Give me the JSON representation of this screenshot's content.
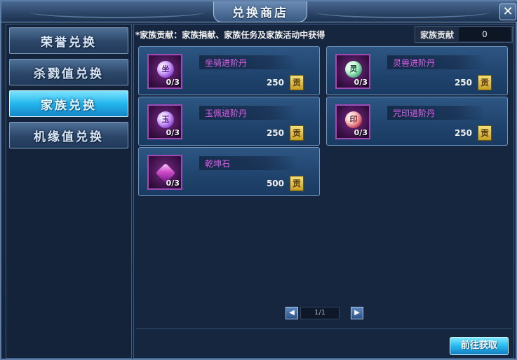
{
  "window": {
    "title": "兑换商店",
    "close_glyph": "✕"
  },
  "sidebar": {
    "tabs": [
      {
        "label": "荣誉兑换",
        "active": false
      },
      {
        "label": "杀戮值兑换",
        "active": false
      },
      {
        "label": "家族兑换",
        "active": true
      },
      {
        "label": "机缘值兑换",
        "active": false
      }
    ]
  },
  "main": {
    "notice": "*家族贡献：家族捐献、家族任务及家族活动中获得",
    "contribution": {
      "label": "家族贡献",
      "value": "0"
    },
    "items": [
      {
        "name": "坐骑进阶丹",
        "orb_glyph": "坐",
        "count": "0/3",
        "price": "250",
        "currency_glyph": "贡",
        "icon": "purple-orb-icon"
      },
      {
        "name": "灵兽进阶丹",
        "orb_glyph": "灵",
        "count": "0/3",
        "price": "250",
        "currency_glyph": "贡",
        "icon": "green-orb-icon"
      },
      {
        "name": "玉佩进阶丹",
        "orb_glyph": "玉",
        "count": "0/3",
        "price": "250",
        "currency_glyph": "贡",
        "icon": "purple-orb-icon"
      },
      {
        "name": "咒印进阶丹",
        "orb_glyph": "印",
        "count": "0/3",
        "price": "250",
        "currency_glyph": "贡",
        "icon": "red-orb-icon"
      },
      {
        "name": "乾坤石",
        "orb_glyph": "",
        "count": "0/3",
        "price": "500",
        "currency_glyph": "贡",
        "icon": "crystal-icon"
      }
    ],
    "pagination": {
      "prev_glyph": "◀",
      "next_glyph": "▶",
      "page_text": "1/1"
    },
    "goto_button": "前往获取"
  },
  "colors": {
    "accent": "#23b6ec",
    "item_name": "#e25ce8",
    "panel": "#16263e"
  }
}
